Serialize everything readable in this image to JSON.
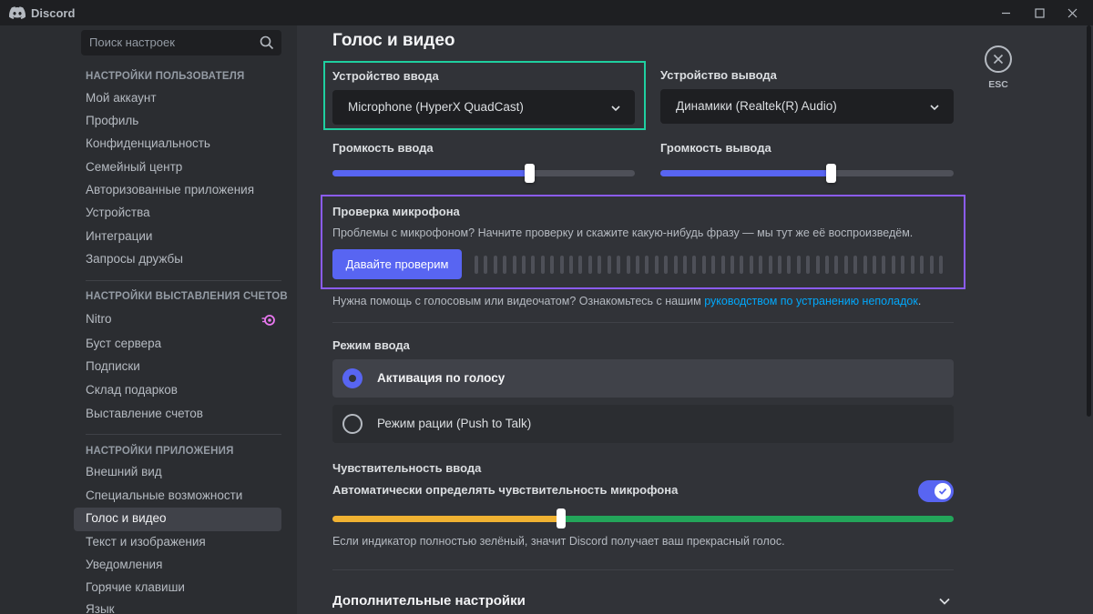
{
  "titlebar": {
    "app_name": "Discord",
    "minimize_glyph": "—",
    "maximize_glyph": "☐",
    "close_glyph": "✕"
  },
  "search": {
    "placeholder": "Поиск настроек"
  },
  "sidebar": {
    "sections": [
      {
        "header": "НАСТРОЙКИ ПОЛЬЗОВАТЕЛЯ",
        "items": [
          "Мой аккаунт",
          "Профиль",
          "Конфиденциальность",
          "Семейный центр",
          "Авторизованные приложения",
          "Устройства",
          "Интеграции",
          "Запросы дружбы"
        ]
      },
      {
        "header": "НАСТРОЙКИ ВЫСТАВЛЕНИЯ СЧЕТОВ",
        "items": [
          "Nitro",
          "Буст сервера",
          "Подписки",
          "Склад подарков",
          "Выставление счетов"
        ]
      },
      {
        "header": "НАСТРОЙКИ ПРИЛОЖЕНИЯ",
        "items": [
          "Внешний вид",
          "Специальные возможности",
          "Голос и видео",
          "Текст и изображения",
          "Уведомления",
          "Горячие клавиши",
          "Язык"
        ]
      }
    ],
    "active_item": "Голос и видео"
  },
  "main": {
    "title": "Голос и видео",
    "input_device": {
      "label": "Устройство ввода",
      "value": "Microphone (HyperX QuadCast)"
    },
    "output_device": {
      "label": "Устройство вывода",
      "value": "Динамики (Realtek(R) Audio)"
    },
    "input_volume": {
      "label": "Громкость ввода",
      "level": 0.65
    },
    "output_volume": {
      "label": "Громкость вывода",
      "level": 0.58
    },
    "mic_test": {
      "label": "Проверка микрофона",
      "description": "Проблемы с микрофоном? Начните проверку и скажите какую-нибудь фразу — мы тут же её воспроизведём.",
      "button": "Давайте проверим"
    },
    "help": {
      "text": "Нужна помощь с голосовым или видеочатом? Ознакомьтесь с нашим ",
      "link": "руководством по устранению неполадок",
      "suffix": "."
    },
    "input_mode": {
      "label": "Режим ввода",
      "options": [
        "Активация по голосу",
        "Режим рации (Push to Talk)"
      ],
      "selected": "Активация по голосу"
    },
    "sensitivity": {
      "label": "Чувствительность ввода",
      "auto_label": "Автоматически определять чувствительность микрофона",
      "auto_enabled": true,
      "threshold": 0.37,
      "note": "Если индикатор полностью зелёный, значит Discord получает ваш прекрасный голос."
    },
    "advanced": {
      "title": "Дополнительные настройки"
    },
    "esc_label": "ESC"
  },
  "colors": {
    "accent": "#5865f2",
    "highlight_green": "#1fd0a0",
    "highlight_purple": "#8b5cf6",
    "link": "#00a8fc"
  }
}
